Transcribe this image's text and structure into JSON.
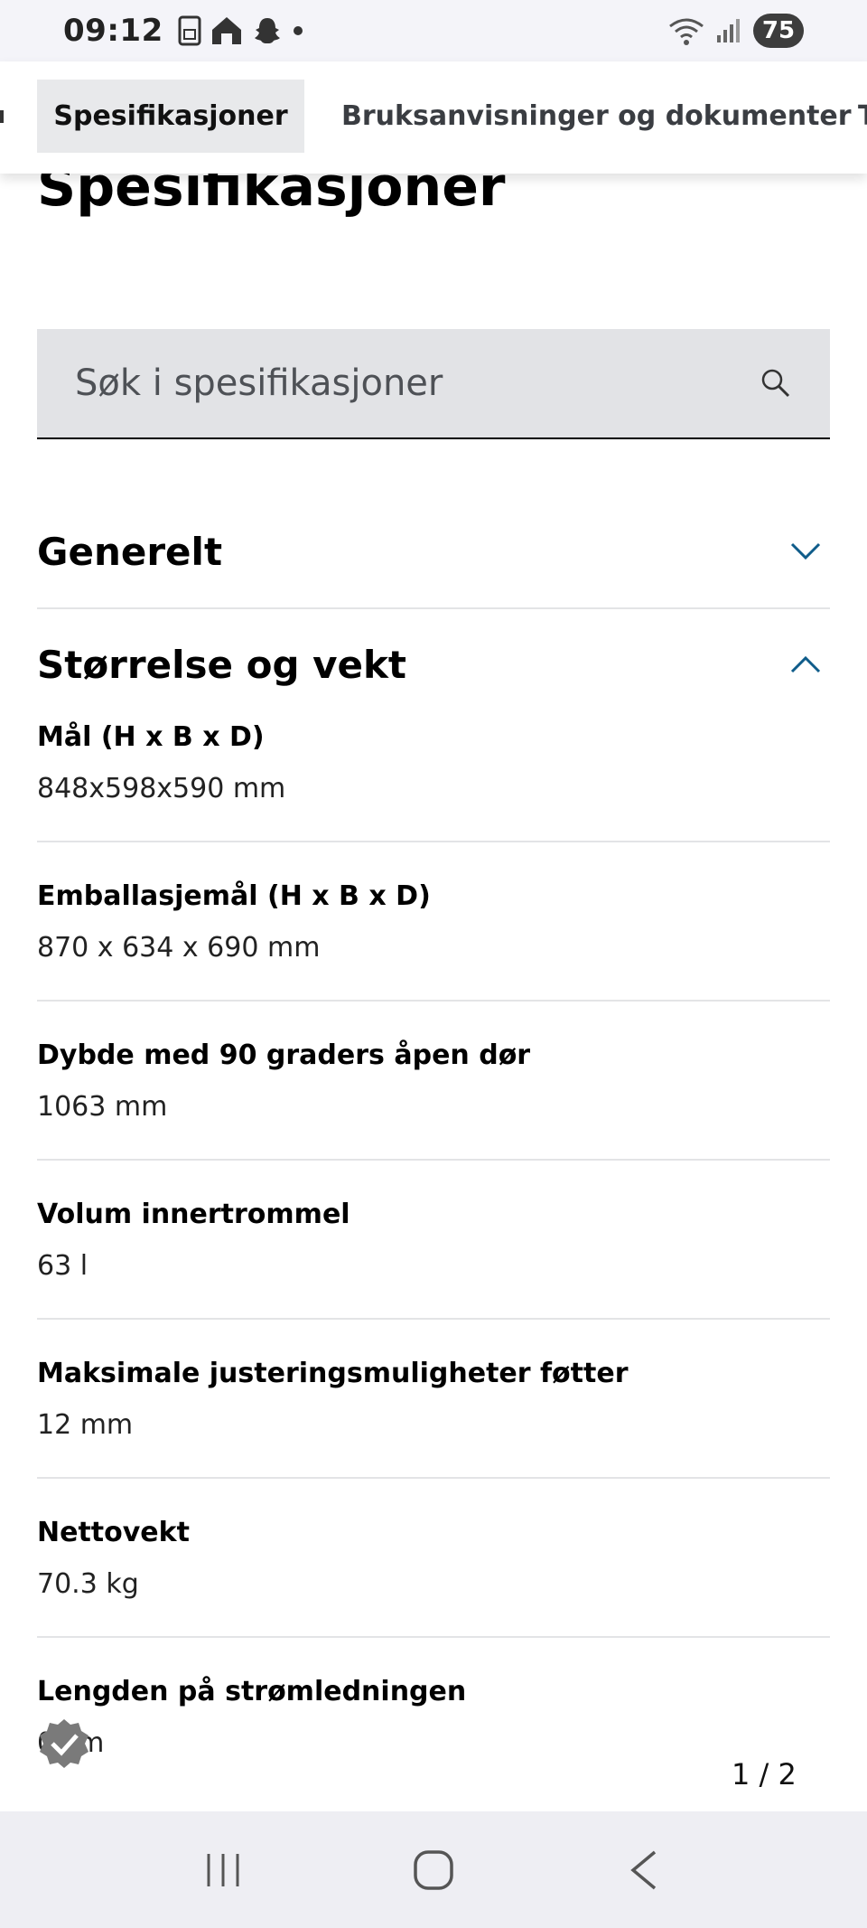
{
  "status_bar": {
    "time": "09:12",
    "battery": "75",
    "icons": [
      "sim-card-icon",
      "home-icon",
      "snapchat-icon",
      "dot-icon",
      "wifi-icon",
      "signal-icon"
    ]
  },
  "tabs": [
    {
      "label": "Spesifikasjoner",
      "active": true
    },
    {
      "label": "Bruksanvisninger og dokumenter",
      "active": false
    },
    {
      "label": "T",
      "active": false
    }
  ],
  "page": {
    "title": "Spesifikasjoner",
    "search_placeholder": "Søk i spesifikasjoner"
  },
  "sections": {
    "general": {
      "label": "Generelt",
      "expanded": false
    },
    "size_weight": {
      "label": "Størrelse og vekt",
      "expanded": true
    }
  },
  "specs": [
    {
      "name": "Mål (H x B x D)",
      "value": "848x598x590 mm"
    },
    {
      "name": "Emballasjemål (H x B x D)",
      "value": "870 x 634 x 690 mm"
    },
    {
      "name": "Dybde med 90 graders åpen dør",
      "value": "1063 mm"
    },
    {
      "name": "Volum innertrommel",
      "value": "63 l"
    },
    {
      "name": "Maksimale justeringsmuligheter føtter",
      "value": "12 mm"
    },
    {
      "name": "Nettovekt",
      "value": "70.3 kg"
    },
    {
      "name": "Lengden på strømledningen",
      "value": "0 cm"
    }
  ],
  "pager": "1 / 2",
  "colors": {
    "accent": "#0f5c8a",
    "search_bg": "#e2e3e6",
    "tab_active_bg": "#e8e9eb"
  }
}
